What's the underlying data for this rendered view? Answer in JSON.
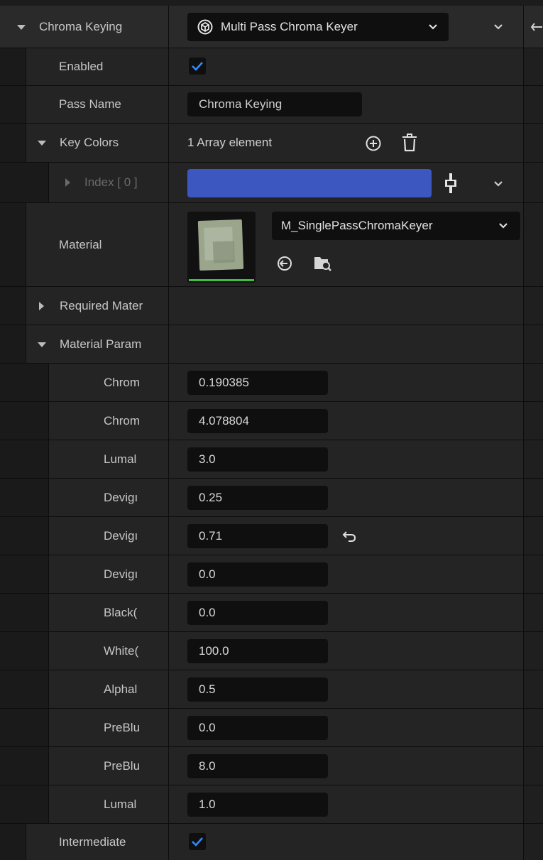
{
  "header": {
    "label": "Chroma Keying",
    "pass_type": "Multi Pass Chroma Keyer"
  },
  "enabled": {
    "label": "Enabled",
    "checked": true
  },
  "pass_name": {
    "label": "Pass Name",
    "value": "Chroma Keying"
  },
  "key_colors": {
    "label": "Key Colors",
    "summary": "1 Array element",
    "index_label": "Index [ 0 ]",
    "color": "#3d57c0"
  },
  "material": {
    "label": "Material",
    "asset": "M_SinglePassChromaKeyer"
  },
  "required_materials": {
    "label": "Required Mater"
  },
  "material_params": {
    "label": "Material Param",
    "params": [
      {
        "label": "Chrom",
        "value": "0.190385"
      },
      {
        "label": "Chrom",
        "value": "4.078804"
      },
      {
        "label": "Lumal",
        "value": "3.0"
      },
      {
        "label": "Devigı",
        "value": "0.25"
      },
      {
        "label": "Devigı",
        "value": "0.71"
      },
      {
        "label": "Devigı",
        "value": "0.0"
      },
      {
        "label": "Black(",
        "value": "0.0"
      },
      {
        "label": "White(",
        "value": "100.0"
      },
      {
        "label": "Alphal",
        "value": "0.5"
      },
      {
        "label": "PreBlu",
        "value": "0.0"
      },
      {
        "label": "PreBlu",
        "value": "8.0"
      },
      {
        "label": "Lumal",
        "value": "1.0"
      }
    ]
  },
  "intermediate": {
    "label": "Intermediate",
    "checked": true
  },
  "colors": {
    "accent": "#2f7fd6",
    "checkmark": "#2f8cff",
    "key_color": "#3d57c0"
  }
}
